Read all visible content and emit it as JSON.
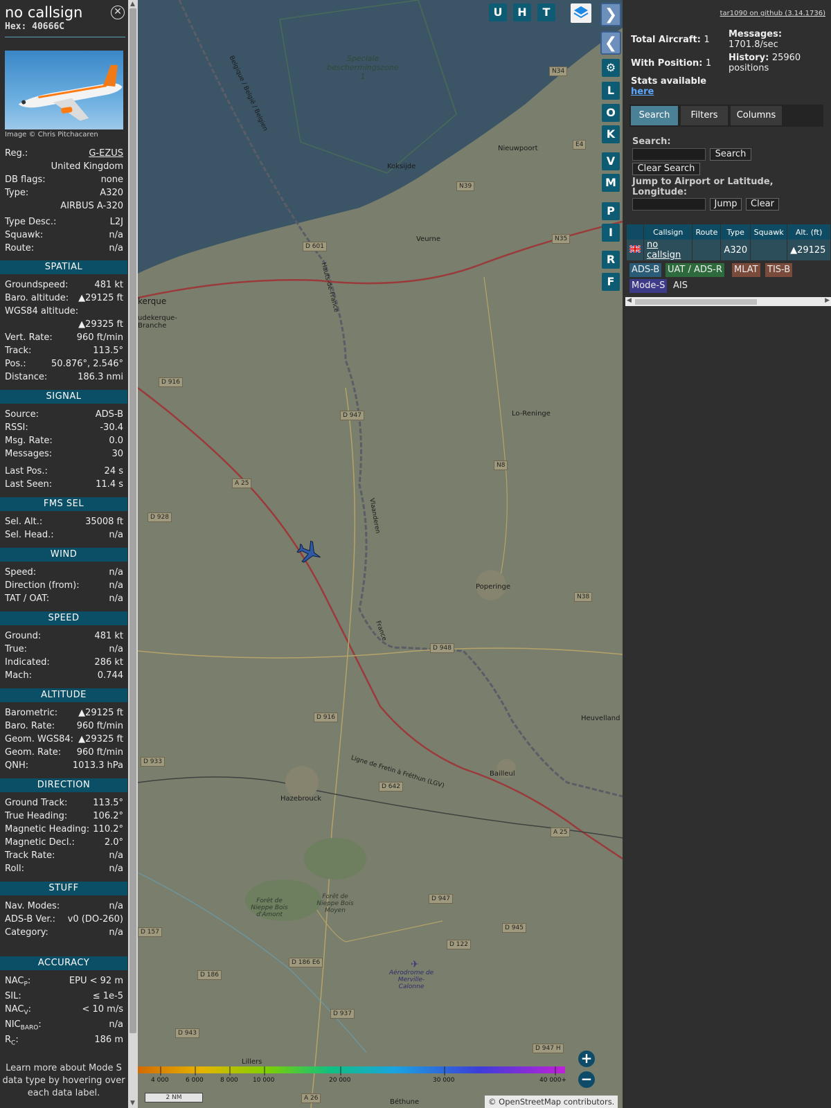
{
  "info": {
    "callsign": "no callsign",
    "hex": "Hex: 40666C",
    "photo_credit": "Image © Chris Pitchacaren",
    "reg_label": "Reg.:",
    "reg": "G-EZUS",
    "country": "United Kingdom",
    "dbflags_label": "DB flags:",
    "dbflags": "none",
    "type_label": "Type:",
    "type": "A320",
    "type_name": "AIRBUS A-320",
    "typedesc_label": "Type Desc.:",
    "typedesc": "L2J",
    "squawk_label": "Squawk:",
    "squawk": "n/a",
    "route_label": "Route:",
    "route": "n/a"
  },
  "spatial": {
    "title": "SPATIAL",
    "gs_label": "Groundspeed:",
    "gs": "481 kt",
    "baro_label": "Baro. altitude:",
    "baro": "▲29125 ft",
    "wgs_label": "WGS84 altitude:",
    "wgs": "▲29325 ft",
    "vr_label": "Vert. Rate:",
    "vr": "960 ft/min",
    "track_label": "Track:",
    "track": "113.5°",
    "pos_label": "Pos.:",
    "pos": "50.876°, 2.546°",
    "dist_label": "Distance:",
    "dist": "186.3 nmi"
  },
  "signal": {
    "title": "SIGNAL",
    "source_label": "Source:",
    "source": "ADS-B",
    "rssi_label": "RSSI:",
    "rssi": "-30.4",
    "msgrate_label": "Msg. Rate:",
    "msgrate": "0.0",
    "messages_label": "Messages:",
    "messages": "30",
    "lastpos_label": "Last Pos.:",
    "lastpos": "24 s",
    "lastseen_label": "Last Seen:",
    "lastseen": "11.4 s"
  },
  "fms": {
    "title": "FMS SEL",
    "selalt_label": "Sel. Alt.:",
    "selalt": "35008 ft",
    "selhead_label": "Sel. Head.:",
    "selhead": "n/a"
  },
  "wind": {
    "title": "WIND",
    "speed_label": "Speed:",
    "speed": "n/a",
    "dir_label": "Direction (from):",
    "dir": "n/a",
    "tat_label": "TAT / OAT:",
    "tat": "n/a"
  },
  "speed": {
    "title": "SPEED",
    "ground_label": "Ground:",
    "ground": "481 kt",
    "true_label": "True:",
    "true": "n/a",
    "ind_label": "Indicated:",
    "ind": "286 kt",
    "mach_label": "Mach:",
    "mach": "0.744"
  },
  "altitude": {
    "title": "ALTITUDE",
    "baro_label": "Barometric:",
    "baro": "▲29125 ft",
    "barorate_label": "Baro. Rate:",
    "barorate": "960 ft/min",
    "geom_label": "Geom. WGS84:",
    "geom": "▲29325 ft",
    "geomrate_label": "Geom. Rate:",
    "geomrate": "960 ft/min",
    "qnh_label": "QNH:",
    "qnh": "1013.3 hPa"
  },
  "direction": {
    "title": "DIRECTION",
    "gt_label": "Ground Track:",
    "gt": "113.5°",
    "th_label": "True Heading:",
    "th": "106.2°",
    "mh_label": "Magnetic Heading:",
    "mh": "110.2°",
    "md_label": "Magnetic Decl.:",
    "md": "2.0°",
    "tr_label": "Track Rate:",
    "tr": "n/a",
    "roll_label": "Roll:",
    "roll": "n/a"
  },
  "stuff": {
    "title": "STUFF",
    "nav_label": "Nav. Modes:",
    "nav": "n/a",
    "adsb_label": "ADS-B Ver.:",
    "adsb": "v0 (DO-260)",
    "cat_label": "Category:",
    "cat": "n/a"
  },
  "accuracy": {
    "title": "ACCURACY",
    "nacp_label": "NAC",
    "nacp_sub": "P",
    "nacp": "EPU < 92 m",
    "sil_label": "SIL:",
    "sil": "≤ 1e-5",
    "nacv_label": "NAC",
    "nacv_sub": "V",
    "nacv": "< 10 m/s",
    "nic_label": "NIC",
    "nic_sub": "BARO",
    "nic": "n/a",
    "rc_label": "R",
    "rc_sub": "C",
    "rc": "186 m"
  },
  "note": "Learn more about Mode S data type by hovering over each data label.",
  "map": {
    "top_buttons": [
      "U",
      "H",
      "T"
    ],
    "side_buttons": [
      "L",
      "O",
      "K",
      "V",
      "M",
      "P",
      "I",
      "R",
      "F"
    ],
    "zone_text": "Speciale beschermingszone 1",
    "places": {
      "koksijde": "Koksijde",
      "nieuwpoort": "Nieuwpoort",
      "veurne": "Veurne",
      "dunkerque": "kerque",
      "teteghem": "udekerque-Branche",
      "loreninge": "Lo-Reninge",
      "poperinge": "Poperinge",
      "heuvelland": "Heuvelland",
      "bailleul": "Bailleul",
      "hazebrouck": "Hazebrouck",
      "lillers": "Lillers",
      "bethune": "Béthune",
      "foret1": "Forêt de Nieppe Bois d'Amont",
      "foret2": "Forêt de Nieppe Bois Moyen",
      "aerodrome": "Aérodrome de Merville-Calonne",
      "lgv": "Ligne de Fretin à Fréthun (LGV)",
      "belgie": "Belgique / België / Belgien",
      "vlaanderen": "Vlaanderen",
      "france": "France",
      "hauts": "Hauts-de-France"
    },
    "roads": {
      "n34": "N34",
      "e40": "E4",
      "n39": "N39",
      "n35": "N35",
      "d601": "D 601",
      "d916a": "D 916",
      "d947a": "D 947",
      "n8": "N8",
      "a25a": "A 25",
      "d928": "D 928",
      "n38": "N38",
      "d948": "D 948",
      "d916b": "D 916",
      "d933": "D 933",
      "d642": "D 642",
      "a25b": "A 25",
      "d947b": "D 947",
      "d945": "D 945",
      "d157": "D 157",
      "d122": "D 122",
      "d186e6": "D 186 E6",
      "d186": "D 186",
      "d937": "D 937",
      "d943": "D 943",
      "d947h": "D 947 H",
      "a26": "A 26"
    },
    "legend_ticks": [
      "4 000",
      "6 000",
      "8 000",
      "10 000",
      "20 000",
      "30 000",
      "40 000+"
    ],
    "scale": "2 NM",
    "attribution_prefix": "© ",
    "attribution_link": "OpenStreetMap",
    "attribution_suffix": " contributors."
  },
  "right": {
    "github": "tar1090 on github (3.14.1736)",
    "total_label": "Total Aircraft:",
    "total": "1",
    "withpos_label": "With Position:",
    "withpos": "1",
    "messages_label": "Messages:",
    "messages_rate": "1701.8/sec",
    "history_label": "History:",
    "history": "25960 positions",
    "stats_text": "Stats available",
    "stats_link": "here",
    "tabs": [
      "Search",
      "Filters",
      "Columns"
    ],
    "search_label": "Search:",
    "search_button": "Search",
    "clear_search_button": "Clear Search",
    "jump_label": "Jump to Airport or Latitude, Longitude:",
    "jump_button": "Jump",
    "clear_button": "Clear",
    "table_headers": [
      "Callsign",
      "Route",
      "Type",
      "Squawk",
      "Alt. (ft)"
    ],
    "row": {
      "callsign": "no callsign",
      "route": "",
      "type": "A320",
      "squawk": "",
      "alt": "▲29125"
    },
    "badges": [
      "ADS-B",
      "UAT / ADS-R",
      "MLAT",
      "TIS-B",
      "Mode-S",
      "AIS"
    ],
    "badge_colors": [
      "#2b5c77",
      "#2e6b3c",
      "#7a4a3a",
      "#7a4a3a",
      "#3d3a8a",
      "#2f2f2f"
    ]
  }
}
